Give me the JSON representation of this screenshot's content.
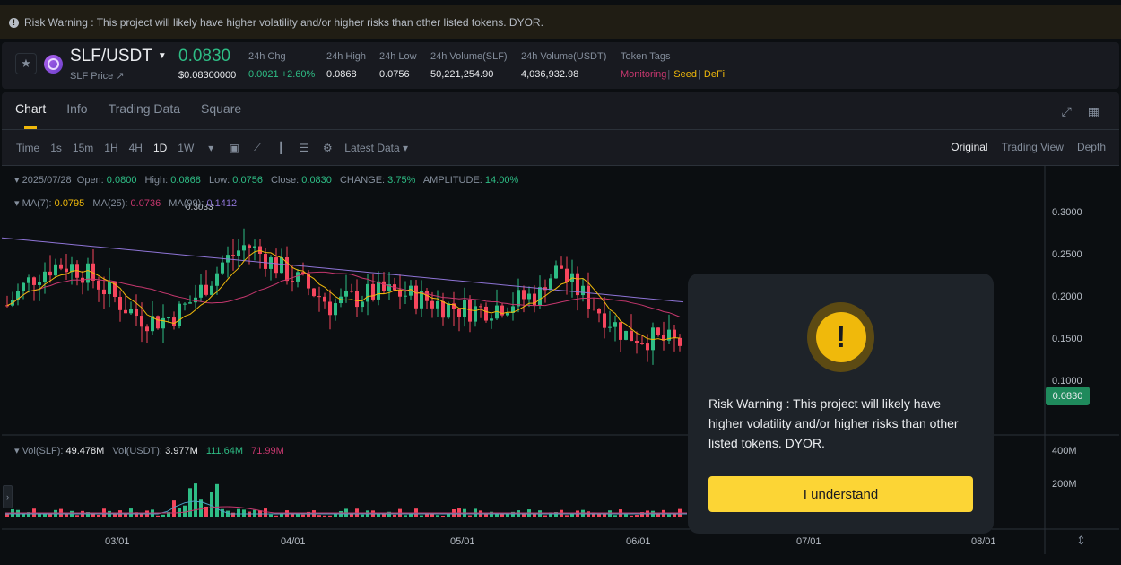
{
  "banner": {
    "text": "Risk Warning : This project will likely have higher volatility and/or higher risks than other listed tokens. DYOR."
  },
  "ticker": {
    "pair": "SLF/USDT",
    "price_link": "SLF Price ↗",
    "last_price": "0.0830",
    "usd_price": "$0.08300000",
    "stats": [
      {
        "label": "24h Chg",
        "value": "0.0021 +2.60%"
      },
      {
        "label": "24h High",
        "value": "0.0868"
      },
      {
        "label": "24h Low",
        "value": "0.0756"
      },
      {
        "label": "24h Volume(SLF)",
        "value": "50,221,254.90"
      },
      {
        "label": "24h Volume(USDT)",
        "value": "4,036,932.98"
      }
    ],
    "tags_label": "Token Tags",
    "tags": [
      {
        "text": "Monitoring",
        "color": "#c6376e"
      },
      {
        "text": "Seed",
        "color": "#f0b90b"
      },
      {
        "text": "DeFi",
        "color": "#f0b90b"
      }
    ]
  },
  "tabs": [
    "Chart",
    "Info",
    "Trading Data",
    "Square"
  ],
  "toolbar": {
    "intervals": [
      "Time",
      "1s",
      "15m",
      "1H",
      "4H",
      "1D",
      "1W"
    ],
    "selected": "1D",
    "latest_data": "Latest Data"
  },
  "views": [
    "Original",
    "Trading View",
    "Depth"
  ],
  "ohlc": {
    "date": "2025/07/28",
    "open_label": "Open:",
    "open": "0.0800",
    "high_label": "High:",
    "high": "0.0868",
    "low_label": "Low:",
    "low": "0.0756",
    "close_label": "Close:",
    "close": "0.0830",
    "change_label": "CHANGE:",
    "change": "3.75%",
    "amp_label": "AMPLITUDE:",
    "amp": "14.00%"
  },
  "ma": {
    "ma7_label": "MA(7):",
    "ma7": "0.0795",
    "ma25_label": "MA(25):",
    "ma25": "0.0736",
    "ma99_label": "MA(99):",
    "ma99": "0.1412"
  },
  "vol": {
    "slf_label": "Vol(SLF):",
    "slf": "49.478M",
    "usdt_label": "Vol(USDT):",
    "usdt": "3.977M",
    "ma1": "111.64M",
    "ma2": "71.99M"
  },
  "y_axis": [
    "0.3000",
    "0.2500",
    "0.2000",
    "0.1500",
    "0.1000"
  ],
  "vol_axis": [
    "400M",
    "200M"
  ],
  "x_axis": [
    "03/01",
    "04/01",
    "05/01",
    "06/01",
    "07/01",
    "08/01"
  ],
  "current_price_tag": "0.0830",
  "high_marker": "0.3033",
  "modal": {
    "text": "Risk Warning : This project will likely have higher volatility and/or higher risks than other listed tokens. DYOR.",
    "button": "I understand"
  },
  "colors": {
    "up": "#2ebd85",
    "down": "#f6465d",
    "accent": "#fcd535"
  }
}
